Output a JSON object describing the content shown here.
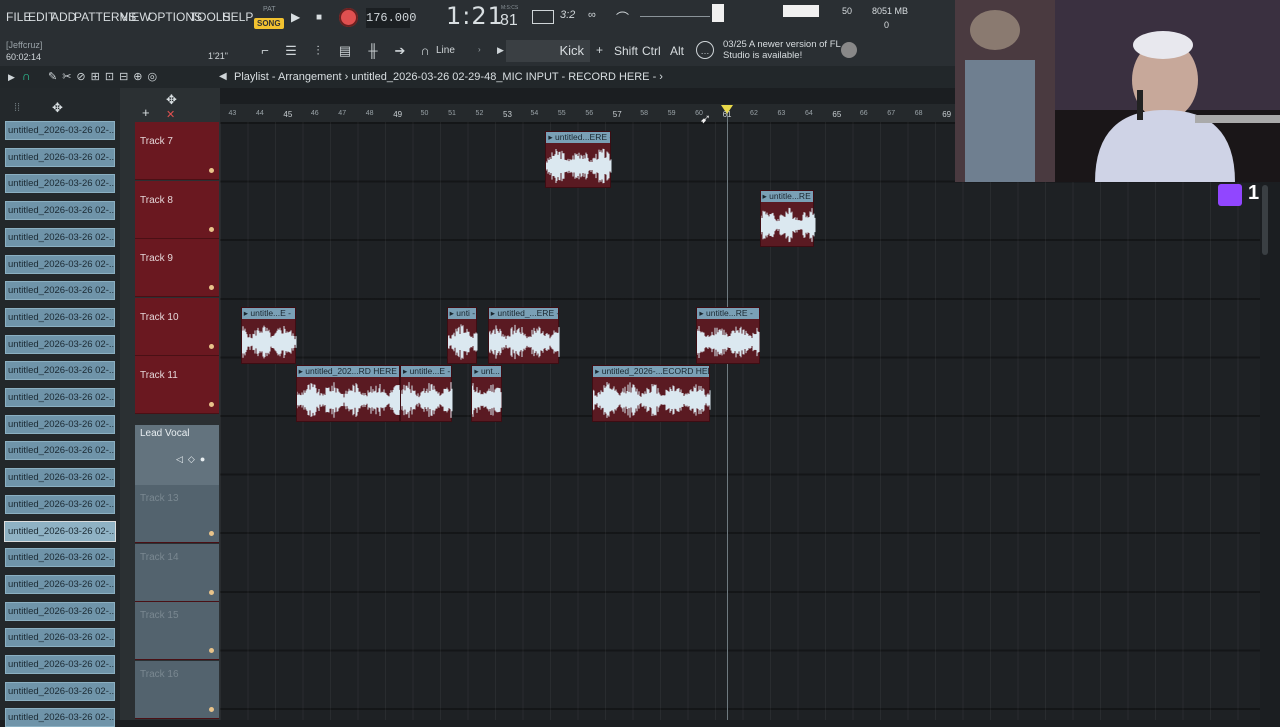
{
  "menu": [
    "FILE",
    "EDIT",
    "ADD",
    "PATTERNS",
    "VIEW",
    "OPTIONS",
    "TOOLS",
    "HELP"
  ],
  "transport": {
    "pat": "PAT",
    "song": "SONG",
    "play": "▶",
    "stop": "■",
    "tempo": "176.000",
    "time": "1:21",
    "time_ms": "81",
    "msc": "M:S:CS"
  },
  "top_right": {
    "meter_value": "50",
    "memory": "8051 MB",
    "cpu": "0"
  },
  "hint": {
    "user": "[Jeffcruz]",
    "time": "60:02:14",
    "pos": "1'21\""
  },
  "toolbar2": {
    "snap": "Line",
    "pattern": "Kick",
    "mods": [
      "Shift",
      "Ctrl",
      "Alt"
    ],
    "news_date": "03/25",
    "news_text": "A newer version of FL Studio is available!"
  },
  "breadcrumb": "Playlist - Arrangement › untitled_2026-03-26 02-29-48_MIC INPUT - RECORD HERE - ›",
  "browser": {
    "items": [
      "untitled_2026-03-26 02-...",
      "untitled_2026-03-26 02-...",
      "untitled_2026-03-26 02-...",
      "untitled_2026-03-26 02-...",
      "untitled_2026-03-26 02-...",
      "untitled_2026-03-26 02-...",
      "untitled_2026-03-26 02-...",
      "untitled_2026-03-26 02-...",
      "untitled_2026-03-26 02-...",
      "untitled_2026-03-26 02-...",
      "untitled_2026-03-26 02-...",
      "untitled_2026-03-26 02-...",
      "untitled_2026-03-26 02-...",
      "untitled_2026-03-26 02-...",
      "untitled_2026-03-26 02-...",
      "untitled_2026-03-26 02-...",
      "untitled_2026-03-26 02-...",
      "untitled_2026-03-26 02-...",
      "untitled_2026-03-26 02-...",
      "untitled_2026-03-26 02-...",
      "untitled_2026-03-26 02-...",
      "untitled_2026-03-26 02-...",
      "untitled_2026-03-26 02-..."
    ],
    "selected_index": 15
  },
  "tracks": [
    {
      "name": "Track 7"
    },
    {
      "name": "Track 8"
    },
    {
      "name": "Track 9"
    },
    {
      "name": "Track 10"
    },
    {
      "name": "Track 11"
    }
  ],
  "lead": {
    "name": "Lead Vocal"
  },
  "grey_tracks": [
    {
      "name": "Track 13"
    },
    {
      "name": "Track 14"
    },
    {
      "name": "Track 15"
    },
    {
      "name": "Track 16"
    }
  ],
  "ruler": {
    "labels": [
      "43",
      "44",
      "45",
      "46",
      "47",
      "48",
      "49",
      "50",
      "51",
      "52",
      "53",
      "54",
      "55",
      "56",
      "57",
      "58",
      "59",
      "60",
      "61",
      "62",
      "63",
      "64",
      "65",
      "66",
      "67",
      "68",
      "69"
    ],
    "major": [
      "45",
      "49",
      "53",
      "57",
      "61",
      "65",
      "69"
    ]
  },
  "clips": [
    {
      "track": 0,
      "title": "untitled...ERE",
      "start_bar": 54.4,
      "end_bar": 56.8
    },
    {
      "track": 1,
      "title": "untitle...RE",
      "start_bar": 62.2,
      "end_bar": 64.2
    },
    {
      "track": 3,
      "title": "untitle...E",
      "start_bar": 43.3,
      "end_bar": 45.3
    },
    {
      "track": 3,
      "title": "unti",
      "start_bar": 50.8,
      "end_bar": 51.9
    },
    {
      "track": 3,
      "title": "untitled_...ERE",
      "start_bar": 52.3,
      "end_bar": 54.9
    },
    {
      "track": 3,
      "title": "untitle...RE",
      "start_bar": 59.9,
      "end_bar": 62.2
    },
    {
      "track": 4,
      "title": "untitled_202...RD HERE",
      "start_bar": 45.3,
      "end_bar": 49.1
    },
    {
      "track": 4,
      "title": "untitle...E",
      "start_bar": 49.1,
      "end_bar": 51.0
    },
    {
      "track": 4,
      "title": "unt...",
      "start_bar": 51.7,
      "end_bar": 52.8
    },
    {
      "track": 4,
      "title": "untitled_2026-...ECORD HERE",
      "start_bar": 56.1,
      "end_bar": 60.4
    }
  ],
  "playhead_bar": 61.0,
  "twitch_count": "1",
  "colors": {
    "track_red": "#6a1820",
    "clip_title": "#7aa0b6",
    "wave": "#dbe8f0",
    "song_badge": "#f2c230",
    "record": "#e05050"
  }
}
